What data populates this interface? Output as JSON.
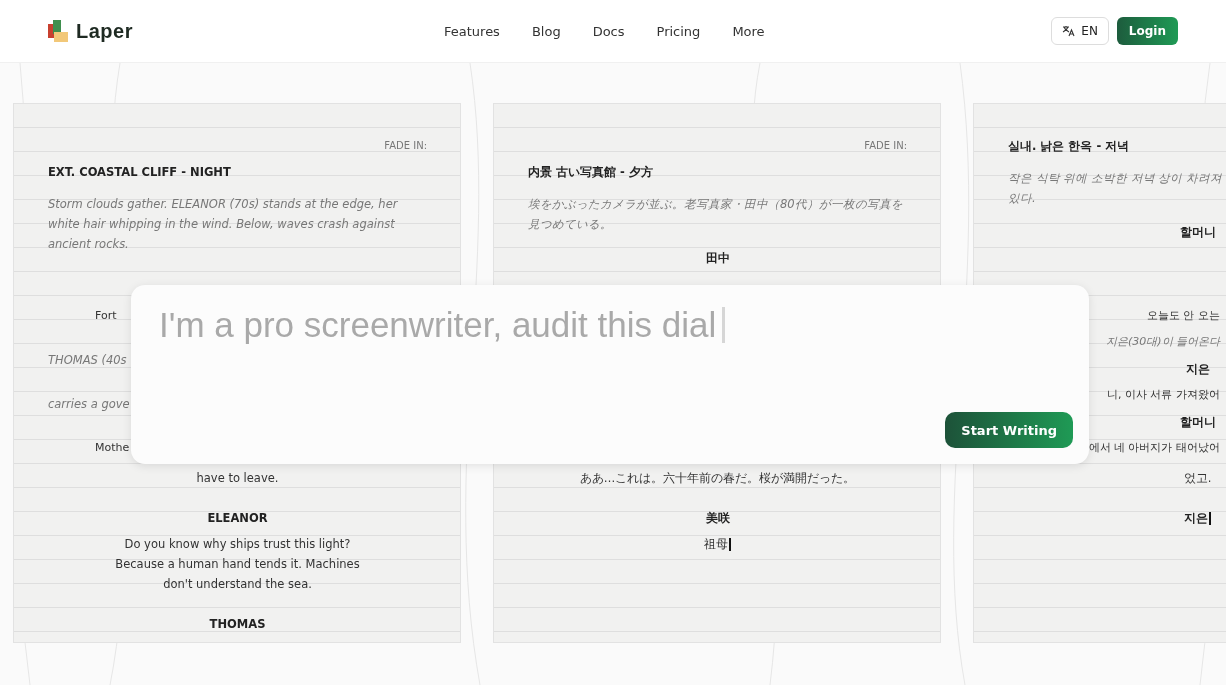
{
  "header": {
    "brand": "Laper",
    "nav": [
      {
        "label": "Features"
      },
      {
        "label": "Blog"
      },
      {
        "label": "Docs"
      },
      {
        "label": "Pricing"
      },
      {
        "label": "More"
      }
    ],
    "language": "EN",
    "login": "Login"
  },
  "scripts": [
    {
      "above": [
        {
          "kind": "transition",
          "text": "FADE IN:"
        },
        {
          "kind": "heading",
          "text": "EXT. COASTAL CLIFF - NIGHT"
        },
        {
          "kind": "action",
          "text": "Storm clouds gather. ELEANOR (70s) stands at the edge, her white hair whipping in the wind. Below, waves crash against ancient rocks."
        }
      ],
      "beside": [
        {
          "kind": "cut",
          "text": "Fort"
        },
        {
          "kind": "action",
          "text": "THOMAS (40s"
        },
        {
          "kind": "action",
          "text": "carries a gove"
        },
        {
          "kind": "cut",
          "text": "Mothe"
        }
      ],
      "below": [
        {
          "kind": "dialogue",
          "text": "have to leave."
        },
        {
          "kind": "character",
          "text": "ELEANOR"
        },
        {
          "kind": "dialogue",
          "text": "Do you know why ships trust this light? Because a human hand tends it. Machines don't understand the sea."
        },
        {
          "kind": "character",
          "text": "THOMAS"
        }
      ]
    },
    {
      "above": [
        {
          "kind": "transition",
          "text": "FADE IN:"
        },
        {
          "kind": "heading",
          "text": "内景 古い写真館 - 夕方"
        },
        {
          "kind": "action",
          "text": "埃をかぶったカメラが並ぶ。老写真家・田中（80代）が一枚の写真を見つめている。"
        },
        {
          "kind": "character",
          "text": "田中"
        }
      ],
      "below": [
        {
          "kind": "dialogue",
          "text": "ああ…これは。六十年前の春だ。桜が満開だった。"
        },
        {
          "kind": "character",
          "text": "美咲"
        },
        {
          "kind": "dialogue",
          "text": "祖母",
          "cursor": true
        }
      ]
    },
    {
      "above": [
        {
          "kind": "heading",
          "text": "실내. 낡은 한옥 - 저녁"
        },
        {
          "kind": "action",
          "text": "작은 식탁 위에 소박한 저녁 상이 차려져"
        },
        {
          "kind": "action",
          "text": "있다."
        },
        {
          "kind": "character",
          "text": "할머니"
        }
      ],
      "beside": [
        {
          "kind": "tail",
          "text": "오늘도 안 오는"
        },
        {
          "kind": "tail-action",
          "text": "지은(30대)이 들어온다"
        },
        {
          "kind": "character",
          "text": "지은"
        },
        {
          "kind": "tail",
          "text": "니, 이사 서류 가져왔어"
        },
        {
          "kind": "character",
          "text": "할머니"
        },
        {
          "kind": "tail",
          "text": "에서 네 아버지가 태어났어"
        }
      ],
      "below": [
        {
          "kind": "dialogue",
          "text": "었고."
        },
        {
          "kind": "character",
          "text": "지은",
          "cursor": true
        }
      ]
    }
  ],
  "prompt": {
    "value": "I'm a pro screenwriter, audit this dial",
    "cursor": true,
    "button": "Start Writing"
  }
}
